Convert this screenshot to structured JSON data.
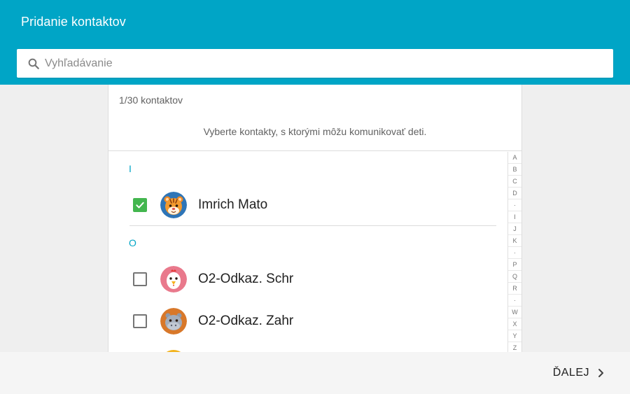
{
  "header": {
    "title": "Pridanie kontaktov"
  },
  "search": {
    "placeholder": "Vyhľadávanie",
    "value": ""
  },
  "list": {
    "count": "1/30 kontaktov",
    "hint": "Vyberte kontakty, s ktorými môžu komunikovať deti.",
    "sections": [
      {
        "letter": "I"
      },
      {
        "letter": "O"
      }
    ],
    "contacts": [
      {
        "name": "Imrich Mato",
        "checked": true,
        "avatar": "tiger-avatar-icon"
      },
      {
        "name": "O2-Odkaz. Schr",
        "checked": false,
        "avatar": "chicken-avatar-icon"
      },
      {
        "name": "O2-Odkaz. Zahr",
        "checked": false,
        "avatar": "hippo-avatar-icon"
      }
    ]
  },
  "alphabet": [
    "A",
    "B",
    "C",
    "D",
    "·",
    "I",
    "J",
    "K",
    "·",
    "P",
    "Q",
    "R",
    "·",
    "W",
    "X",
    "Y",
    "Z"
  ],
  "footer": {
    "next_label": "ĎALEJ"
  },
  "colors": {
    "appbar": "#00a5c6",
    "accent": "#00a5c6",
    "checked": "#43b64f"
  }
}
